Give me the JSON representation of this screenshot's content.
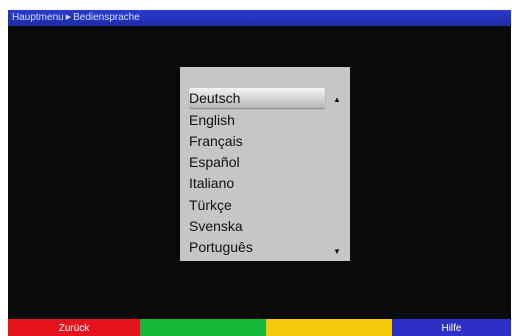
{
  "header": {
    "breadcrumb": [
      "Hauptmenu",
      "Bediensprache"
    ],
    "separator_icon": "triangle-right-icon"
  },
  "language_menu": {
    "selected_index": 0,
    "items": [
      "Deutsch",
      "English",
      "Français",
      "Español",
      "Italiano",
      "Türkçe",
      "Svenska",
      "Português"
    ],
    "scroll_up_icon": "arrow-up-icon",
    "scroll_down_icon": "arrow-down-icon"
  },
  "function_keys": {
    "red": {
      "label": "Zurück",
      "color": "#e5141c"
    },
    "green": {
      "label": "",
      "color": "#16b83a"
    },
    "yellow": {
      "label": "",
      "color": "#f3c90b"
    },
    "blue": {
      "label": "Hilfe",
      "color": "#2d2fc6"
    }
  },
  "colors": {
    "background": "#0a0a0a",
    "header": "#2433b8",
    "menu_background": "#c6c6c6"
  }
}
